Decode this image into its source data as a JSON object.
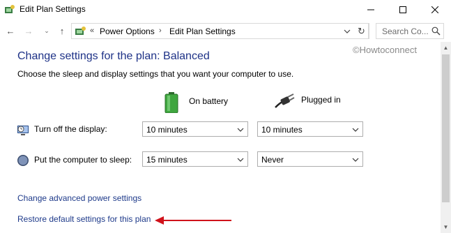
{
  "window": {
    "title": "Edit Plan Settings",
    "minimize_icon": "minimize-icon",
    "maximize_icon": "maximize-icon",
    "close_icon": "close-icon"
  },
  "nav": {
    "back_icon": "←",
    "forward_icon": "→",
    "recent_icon": "⌄",
    "up_icon": "↑",
    "breadcrumb_sep": "«",
    "breadcrumbs": [
      "Power Options",
      "Edit Plan Settings"
    ],
    "crumb_chevron": "›",
    "refresh_icon": "↻",
    "search_placeholder": "Search Co..."
  },
  "watermark": "©Howtoconnect",
  "page": {
    "title": "Change settings for the plan: Balanced",
    "subtitle": "Choose the sleep and display settings that you want your computer to use."
  },
  "columns": {
    "battery": "On battery",
    "plugged": "Plugged in"
  },
  "settings": [
    {
      "label": "Turn off the display:",
      "on_battery": "10 minutes",
      "plugged_in": "10 minutes"
    },
    {
      "label": "Put the computer to sleep:",
      "on_battery": "15 minutes",
      "plugged_in": "Never"
    }
  ],
  "links": {
    "advanced": "Change advanced power settings",
    "restore": "Restore default settings for this plan"
  },
  "colors": {
    "title_blue": "#1e3287",
    "link_blue": "#1e3a8a",
    "annotation_red": "#d0121b"
  }
}
